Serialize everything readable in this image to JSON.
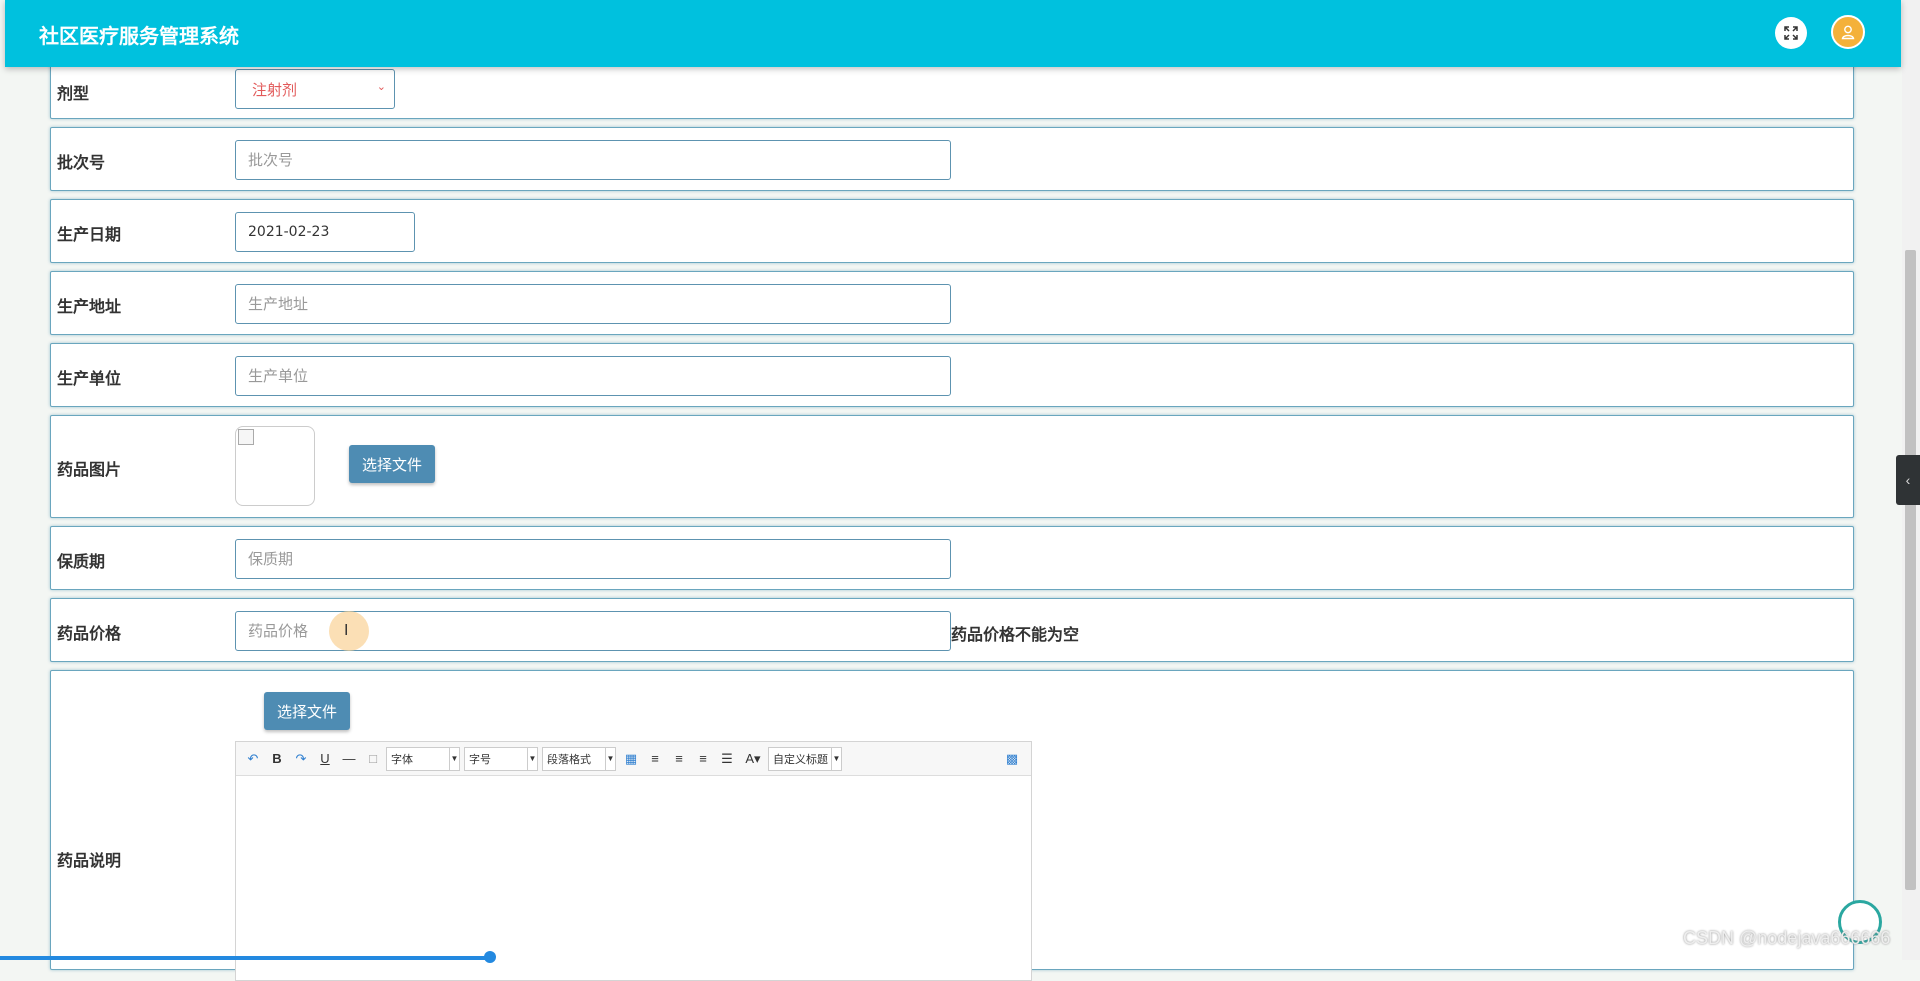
{
  "header": {
    "title": "社区医疗服务管理系统"
  },
  "form": {
    "dosage_form": {
      "label": "剂型",
      "value": "注射剂"
    },
    "batch_no": {
      "label": "批次号",
      "placeholder": "批次号"
    },
    "production_date": {
      "label": "生产日期",
      "value": "2021-02-23"
    },
    "production_address": {
      "label": "生产地址",
      "placeholder": "生产地址"
    },
    "manufacturer": {
      "label": "生产单位",
      "placeholder": "生产单位"
    },
    "drug_image": {
      "label": "药品图片",
      "button": "选择文件"
    },
    "shelf_life": {
      "label": "保质期",
      "placeholder": "保质期"
    },
    "drug_price": {
      "label": "药品价格",
      "placeholder": "药品价格",
      "error": "药品价格不能为空"
    },
    "drug_description": {
      "label": "药品说明",
      "button": "选择文件",
      "toolbar": {
        "font_family": "字体",
        "font_size": "字号",
        "paragraph": "段落格式",
        "custom_title": "自定义标题"
      }
    }
  },
  "watermark": "CSDN @nodejava666666",
  "colors": {
    "header_bg": "#00c1de",
    "button_bg": "#4e8cb3",
    "select_text": "#e25a5a",
    "avatar": "#f4b13a"
  }
}
